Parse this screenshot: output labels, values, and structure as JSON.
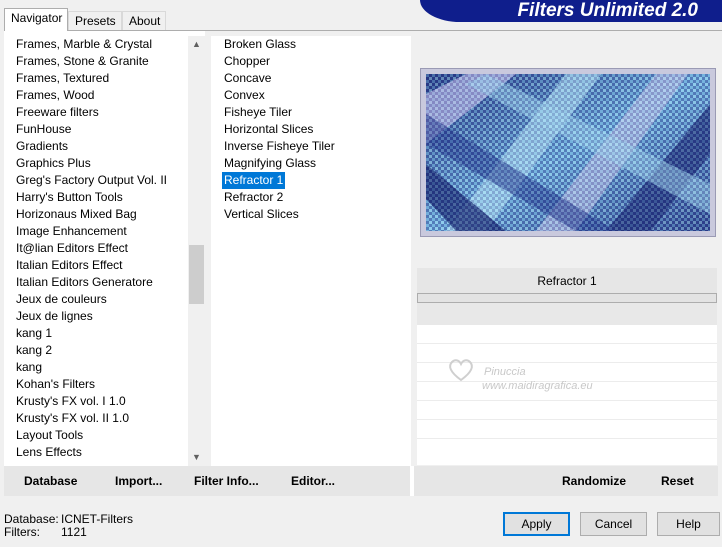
{
  "tabs": [
    "Navigator",
    "Presets",
    "About"
  ],
  "banner_title": "Filters Unlimited 2.0",
  "categories": [
    "Frames, Marble & Crystal",
    "Frames, Stone & Granite",
    "Frames, Textured",
    "Frames, Wood",
    "Freeware filters",
    "FunHouse",
    "Gradients",
    "Graphics Plus",
    "Greg's Factory Output Vol. II",
    "Harry's Button Tools",
    "Horizonaus Mixed Bag",
    "Image Enhancement",
    "It@lian Editors Effect",
    "Italian Editors Effect",
    "Italian Editors Generatore",
    "Jeux de couleurs",
    "Jeux de lignes",
    "kang 1",
    "kang 2",
    "kang",
    "Kohan's Filters",
    "Krusty's FX vol. I 1.0",
    "Krusty's FX vol. II 1.0",
    "Layout Tools",
    "Lens Effects"
  ],
  "filters": [
    "Broken Glass",
    "Chopper",
    "Concave",
    "Convex",
    "Fisheye Tiler",
    "Horizontal Slices",
    "Inverse Fisheye Tiler",
    "Magnifying Glass",
    "Refractor 1",
    "Refractor 2",
    "Vertical Slices"
  ],
  "selected_filter": "Refractor 1",
  "watermark": {
    "line1": "Pinuccia",
    "line2": "www.maidiragrafica.eu"
  },
  "actions": {
    "database": "Database",
    "import": "Import...",
    "filter_info": "Filter Info...",
    "editor": "Editor...",
    "randomize": "Randomize",
    "reset": "Reset"
  },
  "status": {
    "database_label": "Database:",
    "database_value": "ICNET-Filters",
    "filters_label": "Filters:",
    "filters_value": "1121"
  },
  "buttons": {
    "apply": "Apply",
    "cancel": "Cancel",
    "help": "Help"
  },
  "colors": {
    "selection": "#0078d7",
    "banner": "#0f1e8c"
  }
}
